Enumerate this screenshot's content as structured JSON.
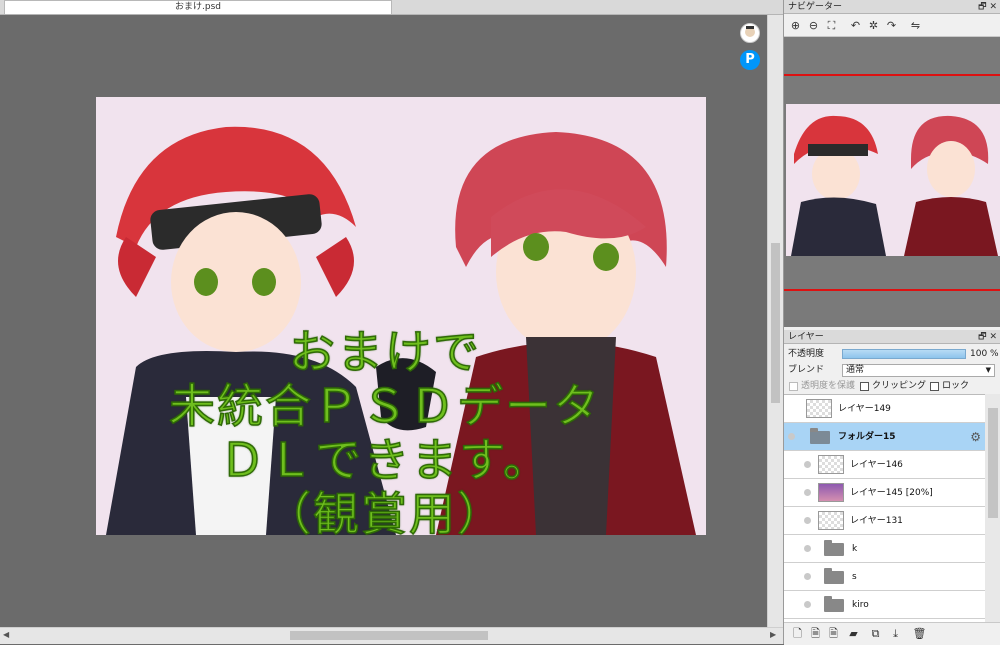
{
  "document": {
    "tab_title": "おまけ.psd"
  },
  "canvas": {
    "overlay_lines": [
      "おまけで",
      "未統合ＰＳＤデータ",
      "ＤＬできます。",
      "（観賞用）"
    ],
    "colors": {
      "background": "#6b6b6b",
      "artwork_bg": "#f1e3ee",
      "overlay_text": "#6fbf1e"
    },
    "icons": {
      "avatar": "avatar-icon",
      "pixiv": "pixiv-icon"
    },
    "pixiv_glyph": "P"
  },
  "navigator": {
    "title": "ナビゲーター",
    "title_buttons": "🗗 ✕",
    "toolbar": [
      {
        "name": "zoom-in-icon",
        "glyph": "⊕"
      },
      {
        "name": "zoom-out-icon",
        "glyph": "⊖"
      },
      {
        "name": "zoom-fit-icon",
        "glyph": "⛶"
      },
      {
        "name": "rotate-left-icon",
        "glyph": "↶"
      },
      {
        "name": "rotate-reset-icon",
        "glyph": "✲"
      },
      {
        "name": "rotate-right-icon",
        "glyph": "↷"
      },
      {
        "name": "flip-icon",
        "glyph": "⇋"
      }
    ]
  },
  "layers": {
    "title": "レイヤー",
    "title_buttons": "🗗 ✕",
    "opacity_label": "不透明度",
    "opacity_value": "100 %",
    "opacity_fraction": 1.0,
    "blend_label": "ブレンド",
    "blend_value": "通常",
    "checks": [
      {
        "label": "透明度を保護",
        "disabled": true
      },
      {
        "label": "クリッピング",
        "disabled": false
      },
      {
        "label": "ロック",
        "disabled": false
      }
    ],
    "items": [
      {
        "name": "レイヤー149",
        "kind": "layer",
        "indent": false,
        "selected": false
      },
      {
        "name": "フォルダー15",
        "kind": "folder",
        "indent": false,
        "selected": true
      },
      {
        "name": "レイヤー146",
        "kind": "layer",
        "indent": true,
        "selected": false
      },
      {
        "name": "レイヤー145 [20%]",
        "kind": "layer-image",
        "indent": true,
        "selected": false
      },
      {
        "name": "レイヤー131",
        "kind": "layer",
        "indent": true,
        "selected": false
      },
      {
        "name": "k",
        "kind": "folder",
        "indent": true,
        "selected": false
      },
      {
        "name": "s",
        "kind": "folder",
        "indent": true,
        "selected": false
      },
      {
        "name": "kiro",
        "kind": "folder",
        "indent": true,
        "selected": false
      }
    ],
    "toolbar": [
      {
        "name": "new-layer-icon",
        "glyph": "🗋"
      },
      {
        "name": "new-layer-alt-icon",
        "glyph": "🗎"
      },
      {
        "name": "new-layer-type-icon",
        "glyph": "🗎"
      },
      {
        "name": "new-folder-icon",
        "glyph": "▰"
      },
      {
        "name": "copy-layer-icon",
        "glyph": "⧉"
      },
      {
        "name": "merge-down-icon",
        "glyph": "⤓"
      },
      {
        "name": "delete-layer-icon",
        "glyph": "🗑"
      }
    ]
  }
}
